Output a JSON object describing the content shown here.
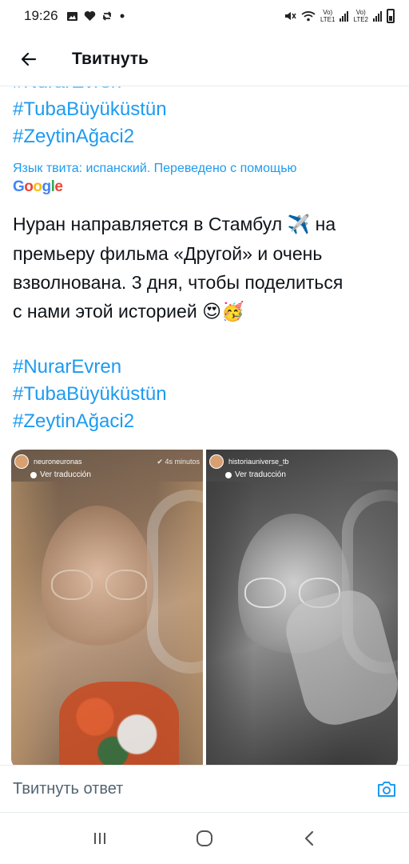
{
  "status_bar": {
    "time": "19:26",
    "left_icons": [
      "image-icon",
      "heart-icon",
      "retweet-icon",
      "dot-icon"
    ],
    "right_icons": [
      "mute-icon",
      "wifi-icon",
      "signal-1-icon",
      "signal-2-icon",
      "battery-icon"
    ],
    "sim1_label_top": "Vo)",
    "sim1_label_bottom": "LTE1",
    "sim2_label_top": "Vo)",
    "sim2_label_bottom": "LTE2"
  },
  "header": {
    "back_icon": "arrow-left-icon",
    "title": "Твитнуть"
  },
  "tweet": {
    "top_hashtags": [
      "#NurarEvren",
      "#TubaBüyüküstün",
      "#ZeytinAğaci2"
    ],
    "translation_note": "Язык твита: испанский. Переведено с помощью",
    "google_logo_text": "Google",
    "translated_text_line1": "Нуран направляется в Стамбул",
    "emoji_plane": "✈️",
    "translated_text_line1b": " на",
    "translated_text_line2": "премьеру фильма «Другой» и очень",
    "translated_text_line3": "взволнована. 3 дня, чтобы поделиться",
    "translated_text_line4": "с нами этой историей",
    "emoji_end": "😍🥳",
    "bottom_hashtags": [
      "#NurarEvren",
      "#TubaBüyüküstün",
      "#ZeytinAğaci2"
    ]
  },
  "media": {
    "left": {
      "username": "neuroneuronas",
      "time": "4s minutos",
      "translate_label": "Ver traducción"
    },
    "right": {
      "username": "historiauniverse_tb",
      "time": "",
      "translate_label": "Ver traducción"
    }
  },
  "reply_bar": {
    "placeholder": "Твитнуть ответ",
    "camera_icon": "camera-icon"
  },
  "nav_bar": {
    "icons": [
      "recents-icon",
      "home-icon",
      "back-icon"
    ]
  },
  "colors": {
    "accent": "#1d9bf0",
    "text": "#0f1419",
    "muted": "#536471"
  }
}
